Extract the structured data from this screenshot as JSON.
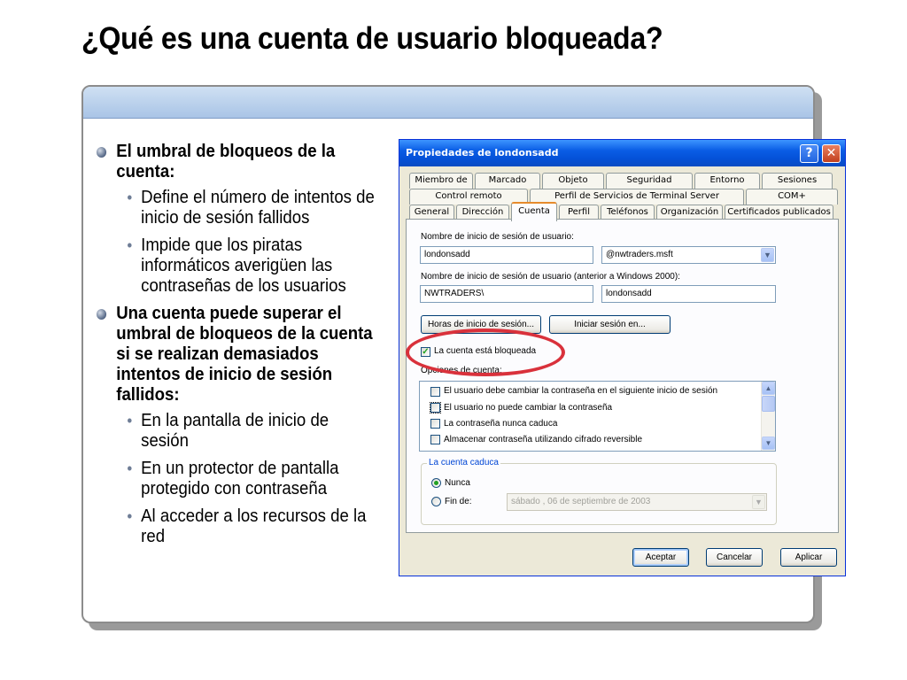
{
  "slide": {
    "title": "¿Qué es una cuenta de usuario bloqueada?",
    "bullets": [
      {
        "text": "El umbral de bloqueos de la cuenta:",
        "sub": [
          "Define el número de intentos de inicio de sesión fallidos",
          "Impide que los piratas informáticos averigüen las contraseñas de los usuarios"
        ]
      },
      {
        "text": "Una cuenta puede superar el umbral de bloqueos de la cuenta si se realizan demasiados intentos de inicio de sesión fallidos:",
        "sub": [
          "En la pantalla de inicio de sesión",
          "En un protector de pantalla protegido con contraseña",
          "Al acceder a los recursos de la red"
        ]
      }
    ]
  },
  "dialog": {
    "title": "Propiedades de londonsadd",
    "help_glyph": "?",
    "close_glyph": "✕",
    "tab_rows": [
      [
        "Miembro de",
        "Marcado",
        "Objeto",
        "Seguridad",
        "Entorno",
        "Sesiones"
      ],
      [
        "Control remoto",
        "Perfil de Servicios de Terminal Server",
        "COM+"
      ],
      [
        "General",
        "Dirección",
        "Cuenta",
        "Perfil",
        "Teléfonos",
        "Organización",
        "Certificados publicados"
      ]
    ],
    "active_tab": "Cuenta",
    "logon_name_label": "Nombre de inicio de sesión de usuario:",
    "logon_name_value": "londonsadd",
    "domain_value": "@nwtraders.msft",
    "pre2000_label": "Nombre de inicio de sesión de usuario (anterior a Windows 2000):",
    "pre2000_domain": "NWTRADERS\\",
    "pre2000_name": "londonsadd",
    "logon_hours_button": "Horas de inicio de sesión...",
    "logon_to_button": "Iniciar sesión en...",
    "locked_checkbox_label": "La cuenta está bloqueada",
    "locked_checked": true,
    "account_options_label": "Opciones de cuenta:",
    "account_options": [
      "El usuario debe cambiar la contraseña en el siguiente inicio de sesión",
      "El usuario no puede cambiar la contraseña",
      "La contraseña nunca caduca",
      "Almacenar contraseña utilizando cifrado reversible"
    ],
    "expires_group_label": "La cuenta caduca",
    "never_label": "Nunca",
    "end_of_label": "Fin de:",
    "end_date_value": "sábado   , 06 de septiembre de 2003",
    "expires_selected": "Nunca",
    "ok_button": "Aceptar",
    "cancel_button": "Cancelar",
    "apply_button": "Aplicar",
    "arrow_down": "▼",
    "arrow_up": "▲",
    "check_glyph": "✓"
  },
  "colors": {
    "highlight": "#d9313b",
    "titlebar": "#0a5de5",
    "bullet": "#5c6e8c"
  }
}
